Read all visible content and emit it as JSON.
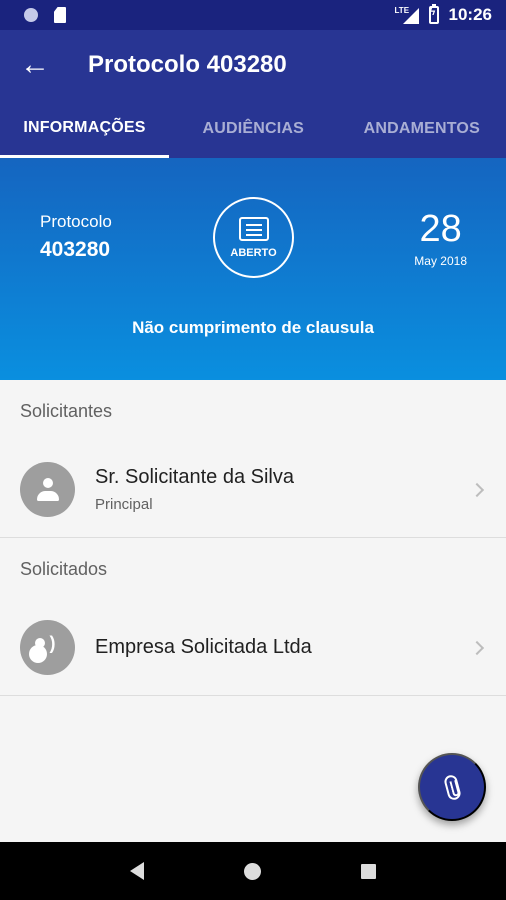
{
  "status_bar": {
    "time": "10:26",
    "network": "LTE",
    "icons": [
      "circle-status-icon",
      "sd-card-icon",
      "lte-signal-icon",
      "battery-charging-icon"
    ]
  },
  "appbar": {
    "back_icon": "arrow-back-icon",
    "title": "Protocolo 403280"
  },
  "tabs": [
    {
      "label": "INFORMAÇÕES",
      "active": true
    },
    {
      "label": "AUDIÊNCIAS",
      "active": false
    },
    {
      "label": "ANDAMENTOS",
      "active": false
    }
  ],
  "summary": {
    "protocol_label": "Protocolo",
    "protocol_number": "403280",
    "status_icon": "message-icon",
    "status": "ABERTO",
    "day": "28",
    "month_year": "May 2018",
    "subject": "Não cumprimento de clausula"
  },
  "solicitantes": {
    "label": "Solicitantes",
    "items": [
      {
        "name": "Sr. Solicitante da Silva",
        "role": "Principal",
        "icon": "person-icon"
      }
    ]
  },
  "solicitados": {
    "label": "Solicitados",
    "items": [
      {
        "name": "Empresa Solicitada Ltda",
        "icon": "group-speaking-icon"
      }
    ]
  },
  "fab": {
    "icon": "attachment-icon"
  },
  "nav_bar": {
    "icons": [
      "nav-back-icon",
      "nav-home-icon",
      "nav-recent-icon"
    ]
  },
  "colors": {
    "primary": "#283593",
    "status_bar": "#1a237e",
    "hero_top": "#1565c0",
    "hero_bottom": "#0a8fdf",
    "background": "#f5f5f5"
  }
}
